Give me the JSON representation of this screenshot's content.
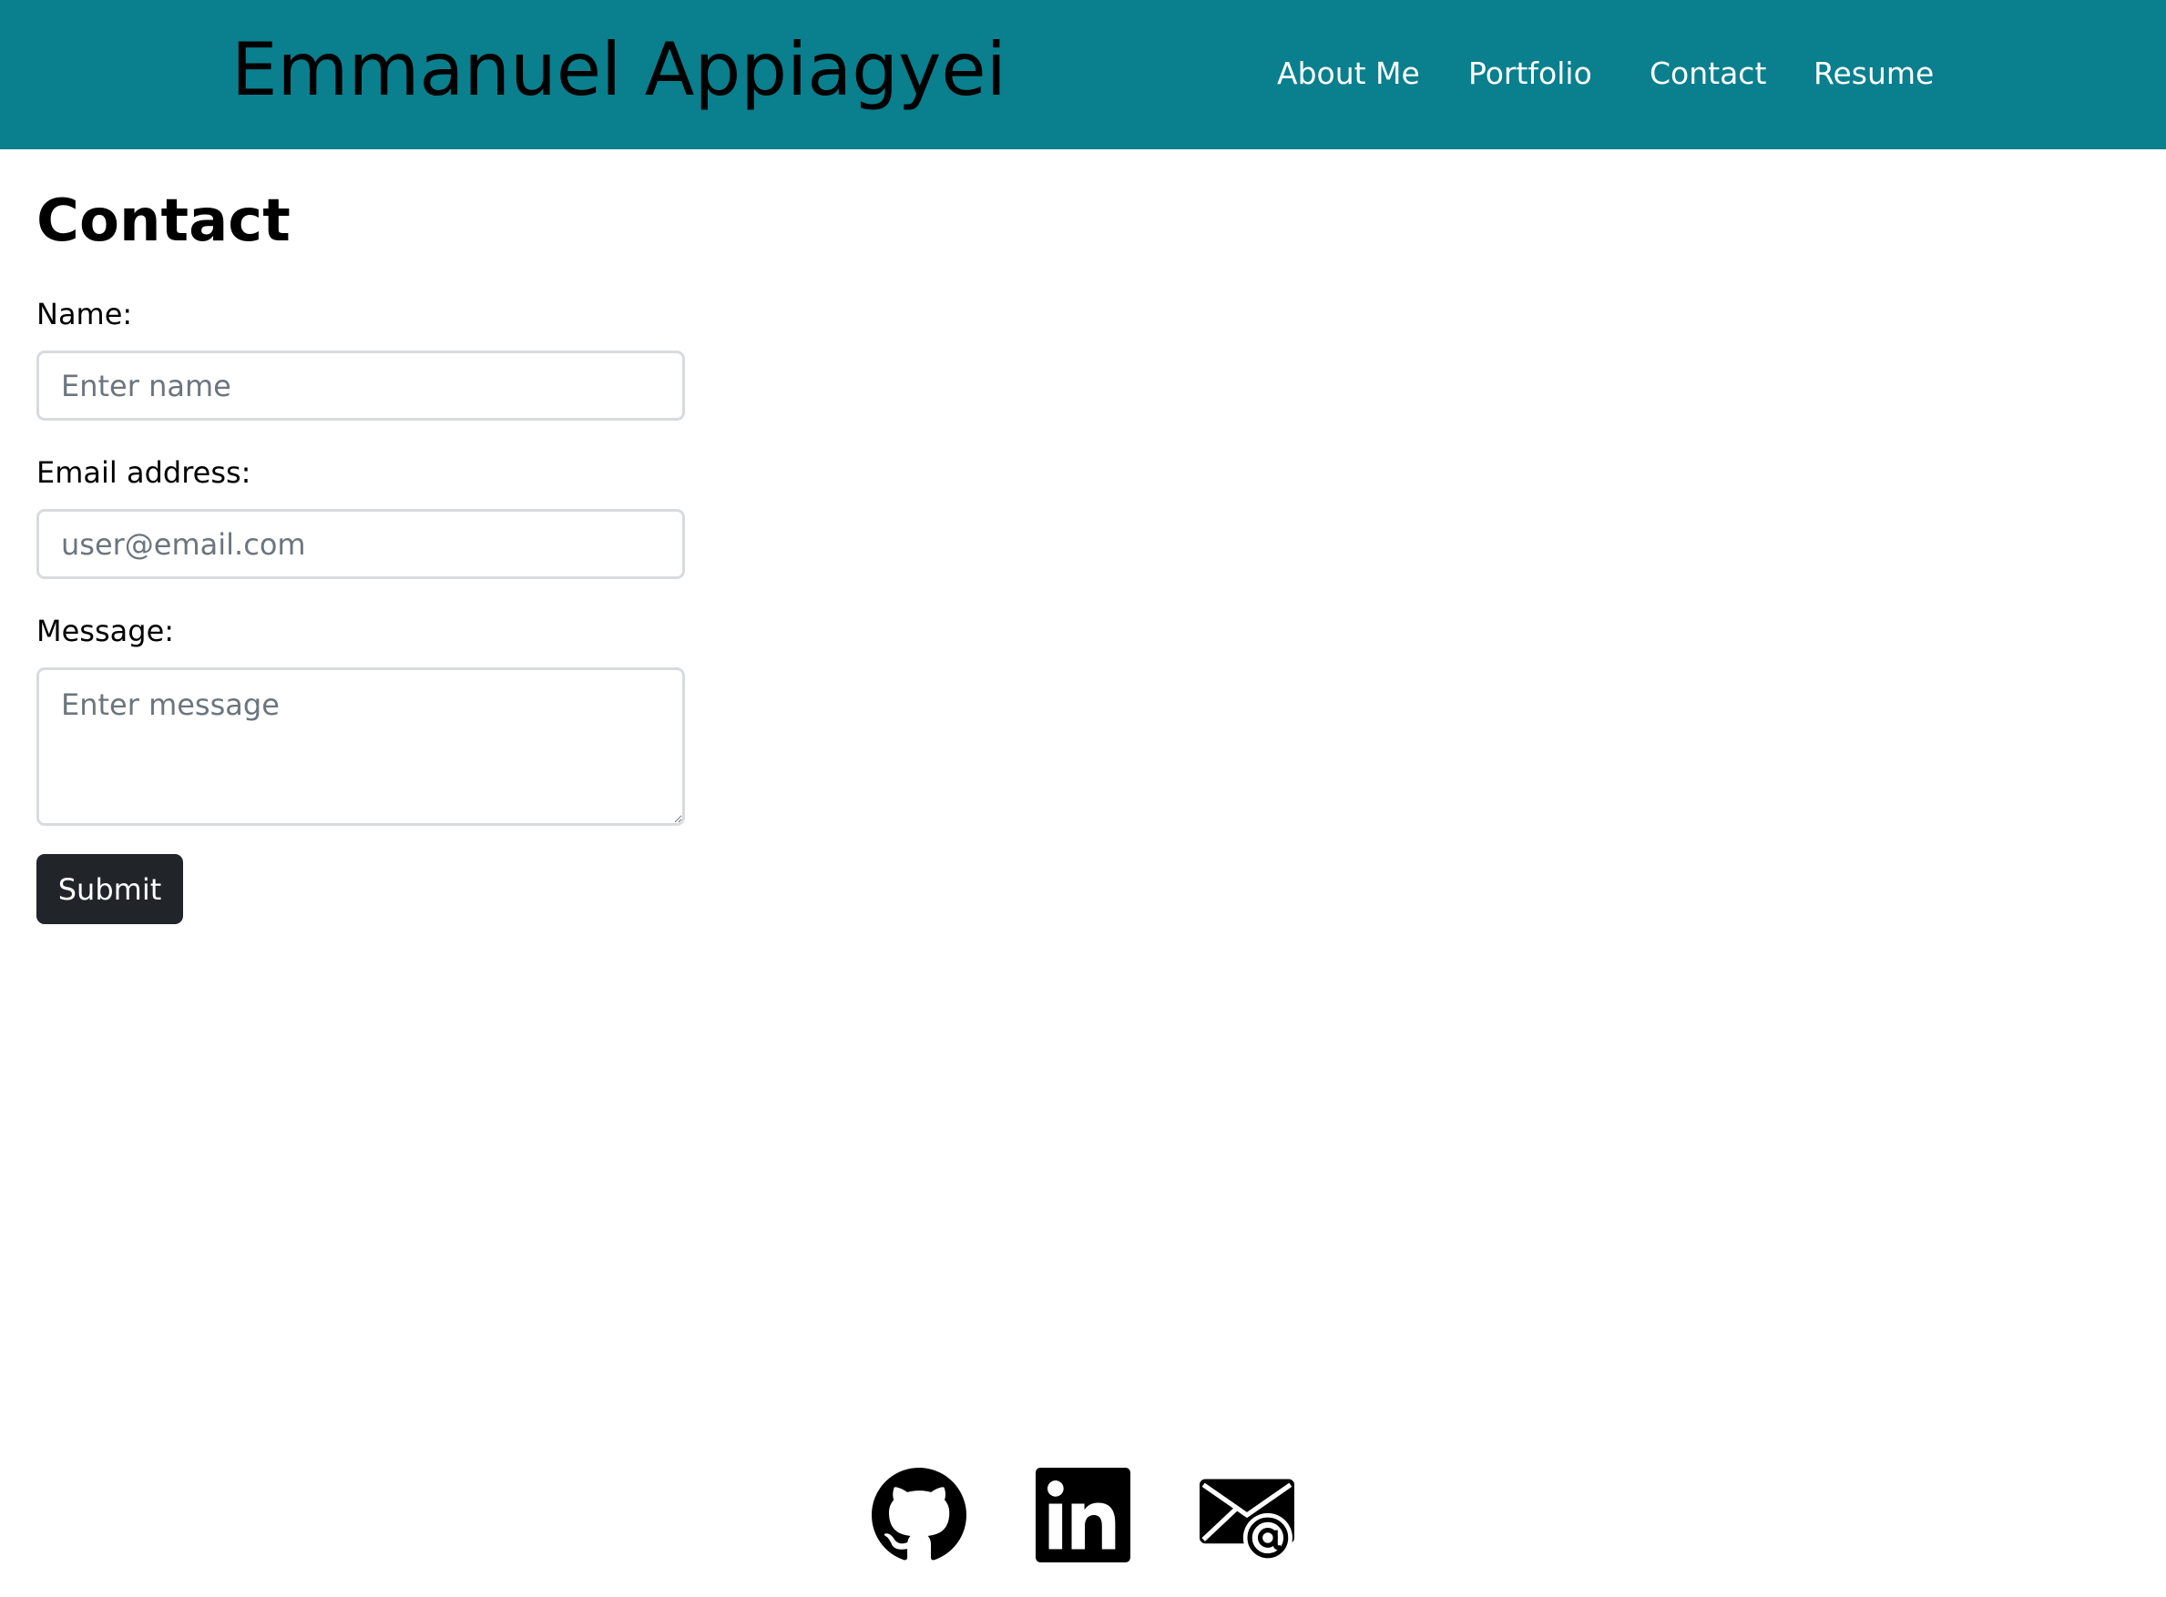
{
  "header": {
    "site_title": "Emmanuel Appiagyei",
    "background_color": "#0a7f8d",
    "nav": [
      {
        "label": "About Me"
      },
      {
        "label": "Portfolio"
      },
      {
        "label": "Contact"
      },
      {
        "label": "Resume"
      }
    ]
  },
  "main": {
    "page_title": "Contact",
    "form": {
      "name_label": "Name:",
      "name_value": "",
      "name_placeholder": "Enter name",
      "email_label": "Email address:",
      "email_value": "",
      "email_placeholder": "user@email.com",
      "message_label": "Message:",
      "message_value": "",
      "message_placeholder": "Enter message",
      "submit_label": "Submit",
      "submit_color": "#212529"
    }
  },
  "footer": {
    "icons": [
      {
        "icon": "github-icon"
      },
      {
        "icon": "linkedin-icon"
      },
      {
        "icon": "email-icon"
      }
    ]
  }
}
